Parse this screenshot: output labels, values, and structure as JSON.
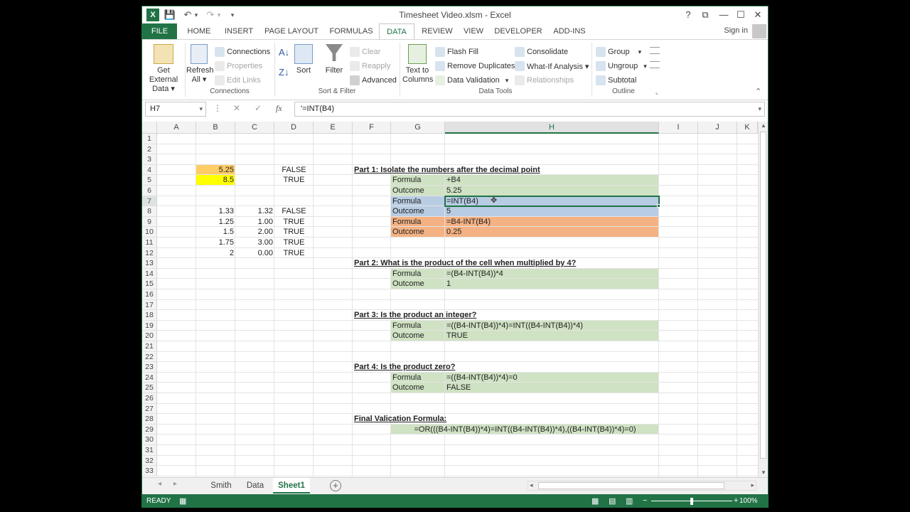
{
  "window": {
    "title": "Timesheet Video.xlsm - Excel",
    "help": "?",
    "ribbon_display": "⧉",
    "minimize": "—",
    "maximize": "☐",
    "close": "✕"
  },
  "quick_access": {
    "excel": "X",
    "save": "💾",
    "undo": "↶",
    "undo_dd": "▾",
    "redo": "↷",
    "redo_dd": "▾",
    "customize": "▾"
  },
  "tabs": [
    "FILE",
    "HOME",
    "INSERT",
    "PAGE LAYOUT",
    "FORMULAS",
    "DATA",
    "REVIEW",
    "VIEW",
    "DEVELOPER",
    "ADD-INS"
  ],
  "signin": "Sign in",
  "ribbon": {
    "get_external_data_1": "Get External",
    "get_external_data_2": "Data ▾",
    "refresh_1": "Refresh",
    "refresh_2": "All ▾",
    "connections": "Connections",
    "properties": "Properties",
    "edit_links": "Edit Links",
    "group_connections": "Connections",
    "sort": "Sort",
    "filter": "Filter",
    "clear": "Clear",
    "reapply": "Reapply",
    "advanced": "Advanced",
    "group_sort_filter": "Sort & Filter",
    "text_to_columns_1": "Text to",
    "text_to_columns_2": "Columns",
    "flash_fill": "Flash Fill",
    "remove_duplicates": "Remove Duplicates",
    "data_validation": "Data Validation",
    "data_validation_dd": "▾",
    "consolidate": "Consolidate",
    "what_if": "What-If Analysis ▾",
    "relationships": "Relationships",
    "group_data_tools": "Data Tools",
    "group": "Group",
    "ungroup": "Ungroup",
    "subtotal": "Subtotal",
    "dd": "▾",
    "group_outline": "Outline",
    "collapse": "⌃",
    "launcher": "⌞"
  },
  "formula_bar": {
    "name_box": "H7",
    "name_dd": "▾",
    "more": "⋮",
    "cancel": "✕",
    "enter": "✓",
    "fx": "fx",
    "formula": "'=INT(B4)",
    "expand": "▾"
  },
  "columns": [
    "A",
    "B",
    "C",
    "D",
    "E",
    "F",
    "G",
    "H",
    "I",
    "J",
    "K"
  ],
  "rows": [
    "1",
    "2",
    "3",
    "4",
    "5",
    "6",
    "7",
    "8",
    "9",
    "10",
    "11",
    "12",
    "13",
    "14",
    "15",
    "16",
    "17",
    "18",
    "19",
    "20",
    "21",
    "22",
    "23",
    "24",
    "25",
    "26",
    "27",
    "28",
    "29",
    "30",
    "31",
    "32",
    "33"
  ],
  "cells": {
    "B4": "5.25",
    "D4": "FALSE",
    "B5": "8.5",
    "D5": "TRUE",
    "B8": "1.33",
    "C8": "1.32",
    "D8": "FALSE",
    "B9": "1.25",
    "C9": "1.00",
    "D9": "TRUE",
    "B10": "1.5",
    "C10": "2.00",
    "D10": "TRUE",
    "B11": "1.75",
    "C11": "3.00",
    "D11": "TRUE",
    "B12": "2",
    "C12": "0.00",
    "D12": "TRUE",
    "F4": "Part 1:  Isolate the numbers after the decimal point",
    "G5": "Formula",
    "H5": "+B4",
    "G6": "Outcome",
    "H6": "5.25",
    "G7": "Formula",
    "H7": "=INT(B4)",
    "G8": "Outcome",
    "H8": "5",
    "G9": "Formula",
    "H9": "=B4-INT(B4)",
    "G10": "Outcome",
    "H10": "0.25",
    "F13": "Part 2: What is the product of the cell when multiplied by 4?",
    "G14": "Formula",
    "H14": "=(B4-INT(B4))*4",
    "G15": "Outcome",
    "H15": "1",
    "F18": "Part 3:  Is the product an integer?",
    "G19": "Formula",
    "H19": "=((B4-INT(B4))*4)=INT((B4-INT(B4))*4)",
    "G20": "Outcome",
    "H20": "TRUE",
    "F23": "Part 4:  Is the product zero?",
    "G24": "Formula",
    "H24": "=((B4-INT(B4))*4)=0",
    "G25": "Outcome",
    "H25": "FALSE",
    "F28": "Final Valication Formula:",
    "G29": "=OR(((B4-INT(B4))*4)=INT((B4-INT(B4))*4),((B4-INT(B4))*4)=0)"
  },
  "sheets": [
    "Smith",
    "Data",
    "Sheet1"
  ],
  "sheet_nav": {
    "prev": "◂",
    "next": "▸",
    "add": "+"
  },
  "status": {
    "ready": "READY",
    "macro": "▦",
    "view_normal": "▦",
    "view_layout": "▤",
    "view_break": "▥",
    "zoom_out": "−",
    "zoom_in": "+",
    "zoom": "100%",
    "zoom_level": 0.5
  },
  "scroll": {
    "up": "▲",
    "down": "▼",
    "left": "◂",
    "right": "▸"
  },
  "colors": {
    "accent": "#217346",
    "orange_cell": "#ffcc66",
    "yellow_cell": "#ffff00",
    "green_band": "#cfe2c3",
    "blue_band": "#b8cce4",
    "salmon_band": "#f4b183"
  }
}
